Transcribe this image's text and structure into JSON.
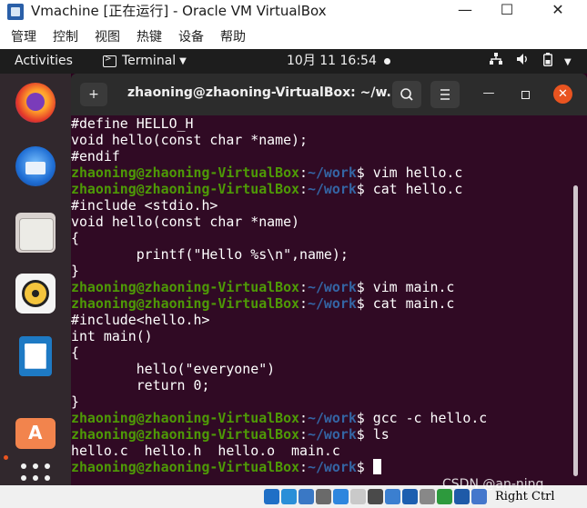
{
  "vbox_window": {
    "title": "Vmachine [正在运行] - Oracle VM VirtualBox",
    "minimize_glyph": "—",
    "maximize_glyph": "☐",
    "close_glyph": "✕",
    "menu": [
      "管理",
      "控制",
      "视图",
      "热键",
      "设备",
      "帮助"
    ]
  },
  "top_bar": {
    "activities": "Activities",
    "app_menu_label": "Terminal",
    "clock": "10月 11  16:54",
    "tray_icons": [
      "network-icon",
      "volume-icon",
      "battery-icon",
      "system-menu-arrow-icon"
    ]
  },
  "dock": {
    "apps": [
      "firefox",
      "thunderbird",
      "files",
      "rhythmbox",
      "libreoffice-writer",
      "ubuntu-software",
      "show-applications"
    ]
  },
  "terminal": {
    "title": "zhaoning@zhaoning-VirtualBox: ~/w...",
    "new_tab_glyph": "+",
    "prompt": {
      "user_host": "zhaoning@zhaoning-VirtualBox",
      "sep": ":",
      "path": "~/work",
      "symbol": "$ "
    },
    "lines": [
      {
        "type": "output",
        "text": "#define HELLO_H"
      },
      {
        "type": "output",
        "text": "void hello(const char *name);"
      },
      {
        "type": "output",
        "text": "#endif"
      },
      {
        "type": "prompt",
        "cmd": "vim hello.c"
      },
      {
        "type": "prompt",
        "cmd": "cat hello.c"
      },
      {
        "type": "output",
        "text": "#include <stdio.h>"
      },
      {
        "type": "output",
        "text": "void hello(const char *name)"
      },
      {
        "type": "output",
        "text": "{"
      },
      {
        "type": "output",
        "text": "        printf(\"Hello %s\\n\",name);"
      },
      {
        "type": "output",
        "text": "}"
      },
      {
        "type": "prompt",
        "cmd": "vim main.c"
      },
      {
        "type": "prompt",
        "cmd": "cat main.c"
      },
      {
        "type": "output",
        "text": "#include<hello.h>"
      },
      {
        "type": "output",
        "text": "int main()"
      },
      {
        "type": "output",
        "text": "{"
      },
      {
        "type": "output",
        "text": "        hello(\"everyone\")"
      },
      {
        "type": "output",
        "text": "        return 0;"
      },
      {
        "type": "output",
        "text": "}"
      },
      {
        "type": "prompt",
        "cmd": "gcc -c hello.c"
      },
      {
        "type": "prompt",
        "cmd": "ls"
      },
      {
        "type": "output",
        "text": "hello.c  hello.h  hello.o  main.c"
      },
      {
        "type": "prompt",
        "cmd": "",
        "cursor": true
      }
    ]
  },
  "status_bar": {
    "host_key": "Right Ctrl",
    "watermark": "CSDN @an-ning",
    "colors": [
      "#1f6fc6",
      "#2a8fd8",
      "#3a78c5",
      "#6a6a6a",
      "#2e86de",
      "#c9c9c9",
      "#4a4a4a",
      "#3b7fd0",
      "#1c5fb0",
      "#888888",
      "#2d9a3d",
      "#1e5aa8",
      "#4477cc"
    ]
  }
}
